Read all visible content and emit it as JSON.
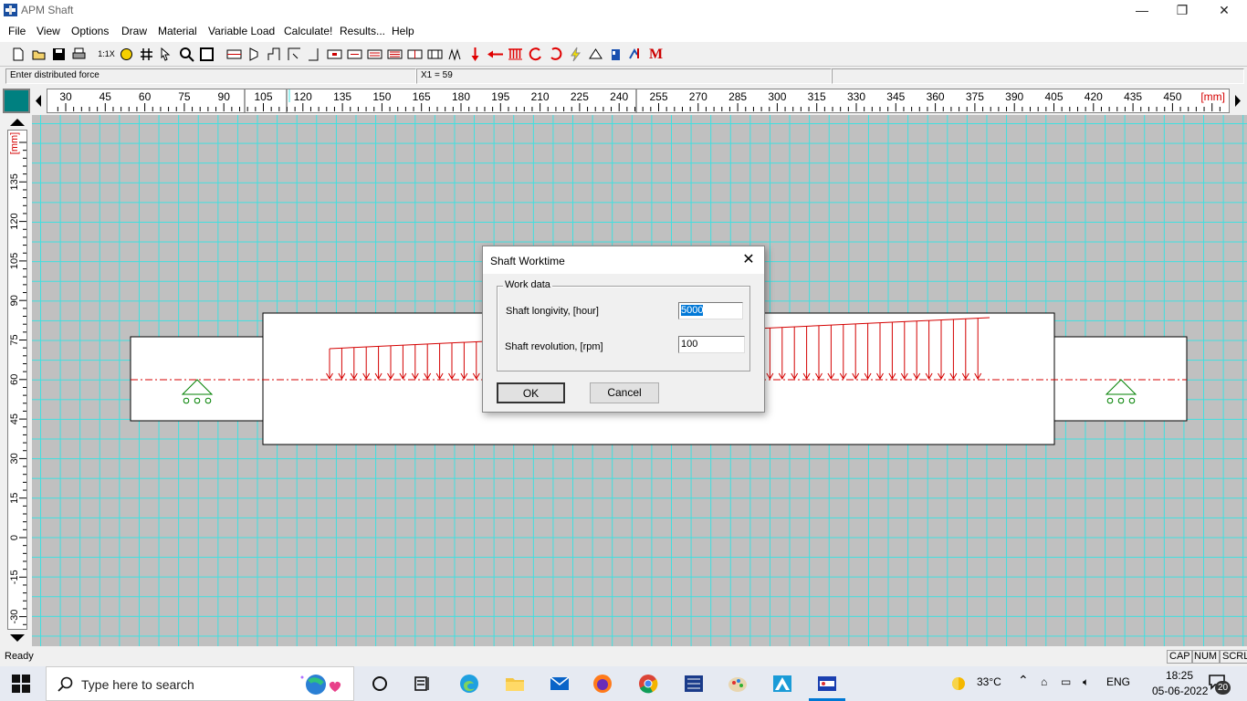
{
  "window": {
    "title": "APM Shaft",
    "minimize": "—",
    "maximize": "❐",
    "close": "✕"
  },
  "menu": [
    "File",
    "View",
    "Options",
    "Draw",
    "Material",
    "Variable Load",
    "Calculate!",
    "Results...",
    "Help"
  ],
  "toolbar": {
    "zoom_label": "1:1X"
  },
  "status_top": {
    "prompt": "Enter distributed force",
    "coord": "X1 = 59"
  },
  "hruler": {
    "unit": "[mm]",
    "labels": [
      30,
      45,
      60,
      75,
      90,
      105,
      120,
      135,
      150,
      165,
      180,
      195,
      210,
      225,
      240,
      255,
      270,
      285,
      300,
      315,
      330,
      345,
      360,
      375,
      390,
      405,
      420,
      435,
      450
    ]
  },
  "vruler": {
    "unit": "[mm]",
    "labels": [
      135,
      120,
      105,
      90,
      75,
      60,
      45,
      30,
      15,
      0,
      -15,
      -30
    ]
  },
  "dialog": {
    "title": "Shaft Worktime",
    "group": "Work data",
    "longevity_label": "Shaft longivity, [hour]",
    "longevity_value": "5000",
    "revolution_label": "Shaft revolution, [rpm]",
    "revolution_value": "100",
    "ok": "OK",
    "cancel": "Cancel",
    "close": "✕"
  },
  "status": {
    "ready": "Ready",
    "cap": "CAP",
    "num": "NUM",
    "scrl": "SCRL"
  },
  "taskbar": {
    "search_placeholder": "Type here to search",
    "temperature": "33°C",
    "language": "ENG",
    "time": "18:25",
    "date": "05-06-2022",
    "notifications": "20"
  },
  "colors": {
    "grid": "#3ee0e0",
    "canvas": "#c0c0c0",
    "force": "#d40000",
    "support": "#008000",
    "axis": "#d40000"
  }
}
